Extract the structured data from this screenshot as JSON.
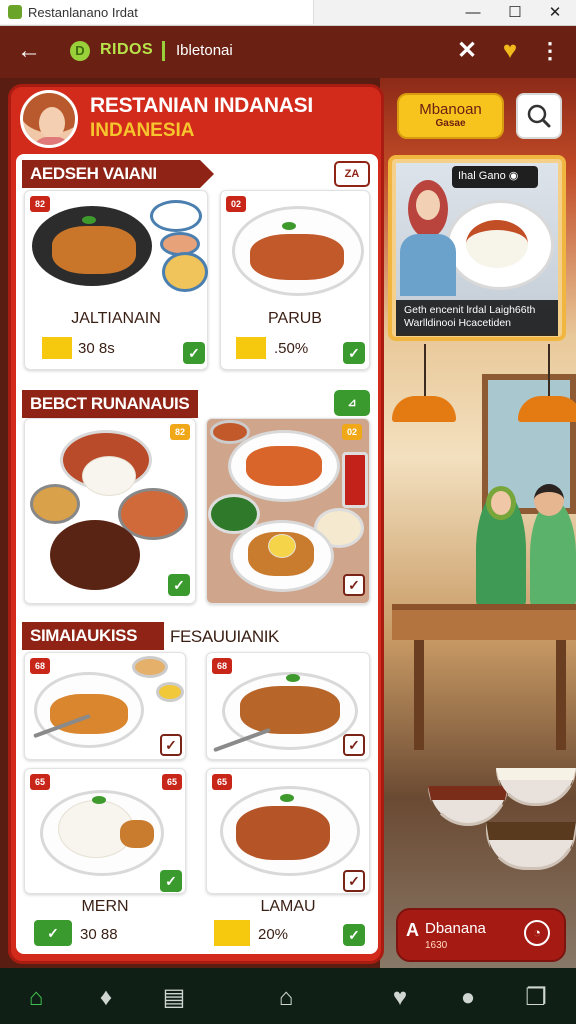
{
  "window": {
    "title": "Restanlanano Irdat",
    "minimize": "—",
    "maximize": "☐",
    "close": "✕"
  },
  "topbar": {
    "back_icon": "arrow-left-icon",
    "brand": "RIDOS",
    "subtitle": "Ibletonai",
    "logo_glyph": "D"
  },
  "header": {
    "title": "RESTANIAN INDANASI",
    "subtitle": "INDANESIA",
    "yellow_button": {
      "line1": "Mbanoan",
      "line2": "Gasae"
    }
  },
  "sections": [
    {
      "title": "AEDSEH VAIANI",
      "corner": "ZA",
      "items": [
        {
          "num": "82",
          "name": "JALTIANAIN",
          "price": "30 8s",
          "checked": true
        },
        {
          "num": "02",
          "name": "PARUB",
          "price": ".50%",
          "checked": true
        }
      ]
    },
    {
      "title": "BEBCT RUNANAUIS",
      "corner": "⊿",
      "items": [
        {
          "num": "82",
          "checked": true
        },
        {
          "num": "02",
          "checked": false
        }
      ]
    },
    {
      "title": "SIMAIAUKISS",
      "title2": "FESAUUIANIK",
      "items": [
        {
          "num": "68",
          "checked": false
        },
        {
          "num": "68",
          "checked": false
        },
        {
          "num": "65",
          "name": "MERN",
          "price": "30 88",
          "checked": true
        },
        {
          "num": "65",
          "name": "LAMAU",
          "price": "20%",
          "checked": true
        }
      ]
    }
  ],
  "photo_card": {
    "badge": "Ihal Gano",
    "caption": "Geth encenit lrdal Laigh66th Warlldinooi Hcacetiden"
  },
  "chat": {
    "title": "Dbanana",
    "prefix": "A",
    "sub": "1630"
  },
  "bottom_nav": [
    {
      "name": "home",
      "glyph": "⌂"
    },
    {
      "name": "tag",
      "glyph": "♦"
    },
    {
      "name": "wallet",
      "glyph": "▤"
    },
    {
      "name": "house",
      "glyph": "⌂"
    },
    {
      "name": "heart",
      "glyph": "♥"
    },
    {
      "name": "chat",
      "glyph": "●"
    },
    {
      "name": "copy",
      "glyph": "❐"
    }
  ],
  "colors": {
    "brand_red": "#d22a1b",
    "dark_maroon": "#6a2113",
    "accent_yellow": "#f7c31d",
    "check_green": "#3a9a2e"
  }
}
